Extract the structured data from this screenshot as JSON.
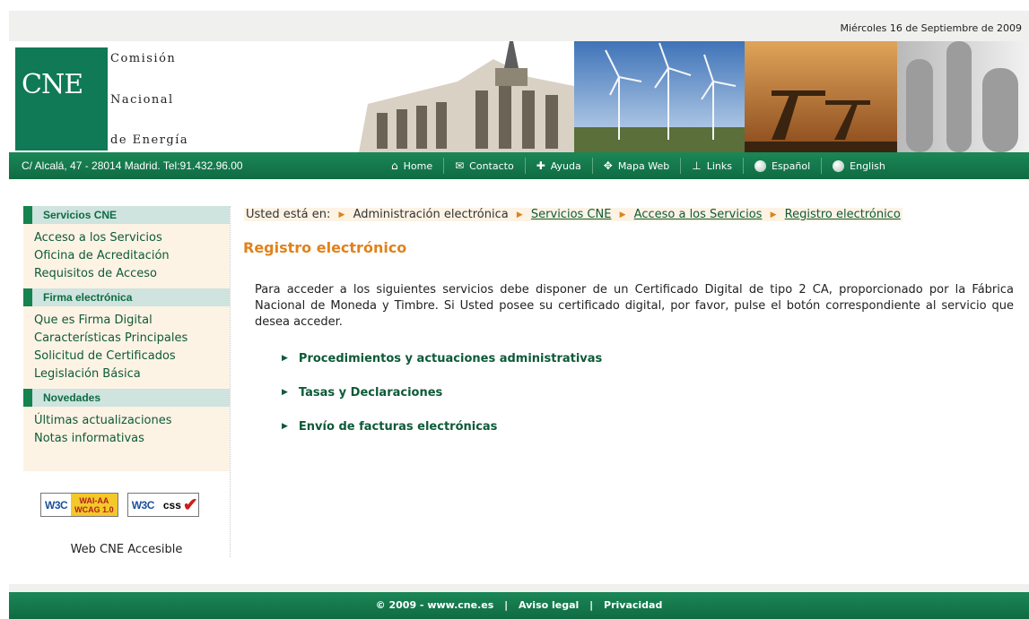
{
  "header": {
    "date": "Miércoles 16 de Septiembre de 2009",
    "logo_text": "CNE",
    "org_line1": "Comisión",
    "org_line2": "Nacional",
    "org_line3": "de Energía",
    "brand_green": "#0f7a55"
  },
  "nav": {
    "address": "C/ Alcalá, 47 - 28014 Madrid. Tel:91.432.96.00",
    "items": [
      {
        "label": "Home",
        "icon": "home-icon"
      },
      {
        "label": "Contacto",
        "icon": "envelope-icon"
      },
      {
        "label": "Ayuda",
        "icon": "plus-icon"
      },
      {
        "label": "Mapa Web",
        "icon": "sitemap-icon"
      },
      {
        "label": "Links",
        "icon": "links-icon"
      },
      {
        "label": "Español",
        "icon": "globe-icon"
      },
      {
        "label": "English",
        "icon": "globe-icon"
      }
    ]
  },
  "sidebar": {
    "sections": [
      {
        "title": "Servicios CNE",
        "links": [
          "Acceso a los Servicios",
          "Oficina de Acreditación",
          "Requisitos de Acceso"
        ]
      },
      {
        "title": "Firma electrónica",
        "links": [
          "Que es Firma Digital",
          "Características Principales",
          "Solicitud de Certificados",
          "Legislación Básica"
        ]
      },
      {
        "title": "Novedades",
        "links": [
          "Últimas actualizaciones",
          "Notas informativas"
        ]
      }
    ],
    "badges": {
      "w3c": "W3C",
      "wai_top": "WAI-AA",
      "wai_bottom": "WCAG 1.0",
      "css": "css"
    },
    "accessible_label": "Web CNE Accesible"
  },
  "main": {
    "breadcrumb": {
      "prefix": "Usted está en:",
      "items": [
        "Administración electrónica",
        "Servicios CNE",
        "Acceso a los Servicios",
        "Registro electrónico"
      ]
    },
    "title": "Registro electrónico",
    "intro": "Para acceder a los siguientes servicios debe disponer de un Certificado Digital de tipo 2 CA, proporcionado por la Fábrica Nacional de Moneda y Timbre. Si Usted posee su certificado digital, por favor, pulse el botón correspondiente al servicio que desea acceder.",
    "services": [
      "Procedimientos y actuaciones administrativas",
      "Tasas y Declaraciones",
      "Envío de facturas electrónicas"
    ]
  },
  "footer": {
    "copyright": "© 2009 - www.cne.es",
    "aviso": "Aviso legal",
    "privacidad": "Privacidad",
    "separator": "|"
  }
}
